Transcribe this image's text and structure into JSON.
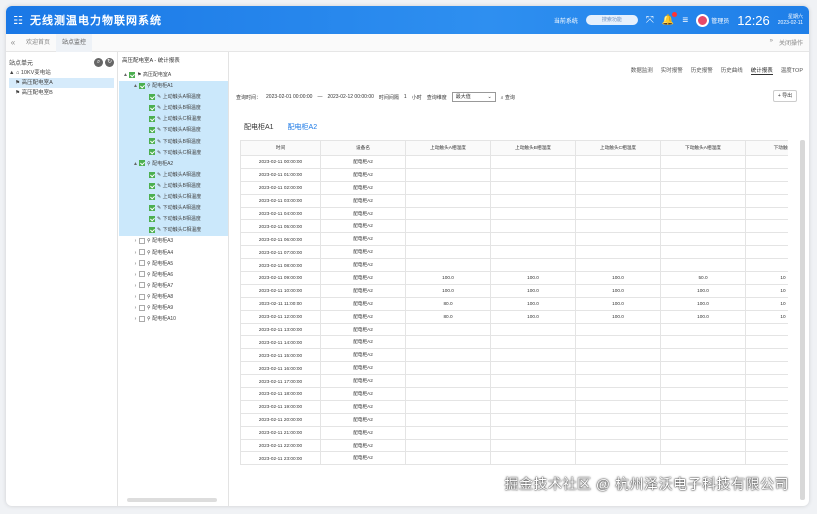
{
  "app": {
    "title": "无线测温电力物联网系统",
    "system_label": "当前系统",
    "search_placeholder": "搜索功能",
    "user": "管理员",
    "time": "12:26",
    "weekday": "星期六",
    "date": "2023-02-11"
  },
  "tabs": {
    "items": [
      "欢迎首页",
      "站点监控"
    ],
    "right": "关闭操作"
  },
  "left_panel": {
    "title": "站点单元",
    "tree": [
      "10KV变电站",
      "高压配电室A",
      "高压配电室B"
    ]
  },
  "mid_panel": {
    "title": "高压配电室A - 统计报表",
    "tree": [
      {
        "label": "高压配电室A",
        "level": 0,
        "checked": true,
        "arrow": "▲",
        "hl": false
      },
      {
        "label": "配电柜A1",
        "level": 1,
        "checked": true,
        "arrow": "▲",
        "hl": true
      },
      {
        "label": "上动触头A相温度",
        "level": 2,
        "checked": true,
        "arrow": "",
        "hl": true
      },
      {
        "label": "上动触头B相温度",
        "level": 2,
        "checked": true,
        "arrow": "",
        "hl": true
      },
      {
        "label": "上动触头C相温度",
        "level": 2,
        "checked": true,
        "arrow": "",
        "hl": true
      },
      {
        "label": "下动触头A相温度",
        "level": 2,
        "checked": true,
        "arrow": "",
        "hl": true
      },
      {
        "label": "下动触头B相温度",
        "level": 2,
        "checked": true,
        "arrow": "",
        "hl": true
      },
      {
        "label": "下动触头C相温度",
        "level": 2,
        "checked": true,
        "arrow": "",
        "hl": true
      },
      {
        "label": "配电柜A2",
        "level": 1,
        "checked": true,
        "arrow": "▲",
        "hl": true
      },
      {
        "label": "上动触头A相温度",
        "level": 2,
        "checked": true,
        "arrow": "",
        "hl": true
      },
      {
        "label": "上动触头B相温度",
        "level": 2,
        "checked": true,
        "arrow": "",
        "hl": true
      },
      {
        "label": "上动触头C相温度",
        "level": 2,
        "checked": true,
        "arrow": "",
        "hl": true
      },
      {
        "label": "下动触头A相温度",
        "level": 2,
        "checked": true,
        "arrow": "",
        "hl": true
      },
      {
        "label": "下动触头B相温度",
        "level": 2,
        "checked": true,
        "arrow": "",
        "hl": true
      },
      {
        "label": "下动触头C相温度",
        "level": 2,
        "checked": true,
        "arrow": "",
        "hl": true
      },
      {
        "label": "配电柜A3",
        "level": 1,
        "checked": false,
        "arrow": "›",
        "hl": false
      },
      {
        "label": "配电柜A4",
        "level": 1,
        "checked": false,
        "arrow": "›",
        "hl": false
      },
      {
        "label": "配电柜A5",
        "level": 1,
        "checked": false,
        "arrow": "›",
        "hl": false
      },
      {
        "label": "配电柜A6",
        "level": 1,
        "checked": false,
        "arrow": "›",
        "hl": false
      },
      {
        "label": "配电柜A7",
        "level": 1,
        "checked": false,
        "arrow": "›",
        "hl": false
      },
      {
        "label": "配电柜A8",
        "level": 1,
        "checked": false,
        "arrow": "›",
        "hl": false
      },
      {
        "label": "配电柜A9",
        "level": 1,
        "checked": false,
        "arrow": "›",
        "hl": false
      },
      {
        "label": "配电柜A10",
        "level": 1,
        "checked": false,
        "arrow": "›",
        "hl": false
      }
    ]
  },
  "main": {
    "tabs": [
      "数据监测",
      "实时报警",
      "历史报警",
      "历史曲线",
      "统计报表",
      "温度TOP"
    ],
    "query": {
      "time_label": "查询时间：",
      "start": "2023-02-01 00:00:00",
      "dash": "—",
      "end": "2023-02-12 00:00:00",
      "interval_label": "时间间隔",
      "interval": "1",
      "unit": "小时",
      "dim_label": "查询维度",
      "dim": "最大值",
      "search": "查询",
      "export": "导出"
    },
    "data_tabs": [
      "配电柜A1",
      "配电柜A2"
    ],
    "table": {
      "headers": [
        "时间",
        "设备名",
        "上动触头A相温度",
        "上动触头B相温度",
        "上动触头C相温度",
        "下动触头A相温度",
        "下动触头"
      ],
      "rows": [
        [
          "2023-02-11 00:00:00",
          "配电柜A2",
          "",
          "",
          "",
          "",
          ""
        ],
        [
          "2023-02-11 01:00:00",
          "配电柜A2",
          "",
          "",
          "",
          "",
          ""
        ],
        [
          "2023-02-11 02:00:00",
          "配电柜A2",
          "",
          "",
          "",
          "",
          ""
        ],
        [
          "2023-02-11 03:00:00",
          "配电柜A2",
          "",
          "",
          "",
          "",
          ""
        ],
        [
          "2023-02-11 04:00:00",
          "配电柜A2",
          "",
          "",
          "",
          "",
          ""
        ],
        [
          "2023-02-11 05:00:00",
          "配电柜A2",
          "",
          "",
          "",
          "",
          ""
        ],
        [
          "2023-02-11 06:00:00",
          "配电柜A2",
          "",
          "",
          "",
          "",
          ""
        ],
        [
          "2023-02-11 07:00:00",
          "配电柜A2",
          "",
          "",
          "",
          "",
          ""
        ],
        [
          "2023-02-11 08:00:00",
          "配电柜A2",
          "",
          "",
          "",
          "",
          ""
        ],
        [
          "2023-02-11 09:00:00",
          "配电柜A2",
          "100.0",
          "100.0",
          "100.0",
          "50.0",
          "10"
        ],
        [
          "2023-02-11 10:00:00",
          "配电柜A2",
          "100.0",
          "100.0",
          "100.0",
          "100.0",
          "10"
        ],
        [
          "2023-02-11 11:00:00",
          "配电柜A2",
          "80.0",
          "100.0",
          "100.0",
          "100.0",
          "10"
        ],
        [
          "2023-02-11 12:00:00",
          "配电柜A2",
          "80.0",
          "100.0",
          "100.0",
          "100.0",
          "10"
        ],
        [
          "2023-02-11 13:00:00",
          "配电柜A2",
          "",
          "",
          "",
          "",
          ""
        ],
        [
          "2023-02-11 14:00:00",
          "配电柜A2",
          "",
          "",
          "",
          "",
          ""
        ],
        [
          "2023-02-11 15:00:00",
          "配电柜A2",
          "",
          "",
          "",
          "",
          ""
        ],
        [
          "2023-02-11 16:00:00",
          "配电柜A2",
          "",
          "",
          "",
          "",
          ""
        ],
        [
          "2023-02-11 17:00:00",
          "配电柜A2",
          "",
          "",
          "",
          "",
          ""
        ],
        [
          "2023-02-11 18:00:00",
          "配电柜A2",
          "",
          "",
          "",
          "",
          ""
        ],
        [
          "2023-02-11 19:00:00",
          "配电柜A2",
          "",
          "",
          "",
          "",
          ""
        ],
        [
          "2023-02-11 20:00:00",
          "配电柜A2",
          "",
          "",
          "",
          "",
          ""
        ],
        [
          "2023-02-11 21:00:00",
          "配电柜A2",
          "",
          "",
          "",
          "",
          ""
        ],
        [
          "2023-02-11 22:00:00",
          "配电柜A2",
          "",
          "",
          "",
          "",
          ""
        ],
        [
          "2023-02-11 23:00:00",
          "配电柜A2",
          "",
          "",
          "",
          "",
          ""
        ]
      ]
    }
  },
  "watermark": "掘金技术社区 @ 杭州泽沃电子科技有限公司"
}
